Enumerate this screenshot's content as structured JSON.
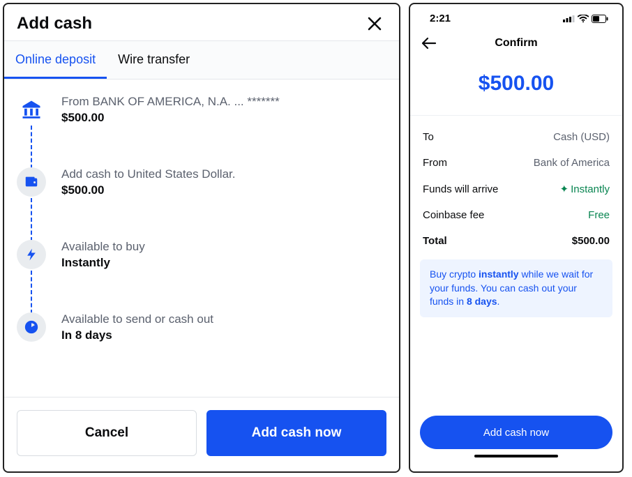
{
  "left": {
    "title": "Add cash",
    "tabs": {
      "online": "Online deposit",
      "wire": "Wire transfer"
    },
    "steps": [
      {
        "label": "From BANK OF AMERICA, N.A. ... *******",
        "value": "$500.00"
      },
      {
        "label": "Add cash to United States Dollar.",
        "value": "$500.00"
      },
      {
        "label": "Available to buy",
        "value": "Instantly"
      },
      {
        "label": "Available to send or cash out",
        "value": "In 8 days"
      }
    ],
    "footer": {
      "cancel": "Cancel",
      "confirm": "Add cash now"
    }
  },
  "right": {
    "status": {
      "time": "2:21"
    },
    "title": "Confirm",
    "amount": "$500.00",
    "rows": {
      "to": {
        "k": "To",
        "v": "Cash (USD)"
      },
      "from": {
        "k": "From",
        "v": "Bank of America"
      },
      "arrive": {
        "k": "Funds will arrive",
        "v": "Instantly"
      },
      "fee": {
        "k": "Coinbase fee",
        "v": "Free"
      },
      "total": {
        "k": "Total",
        "v": "$500.00"
      }
    },
    "info": {
      "t1": "Buy crypto ",
      "b1": "instantly",
      "t2": " while we wait for your funds. You can cash out your funds in ",
      "b2": "8 days",
      "t3": "."
    },
    "cta": "Add cash now"
  }
}
